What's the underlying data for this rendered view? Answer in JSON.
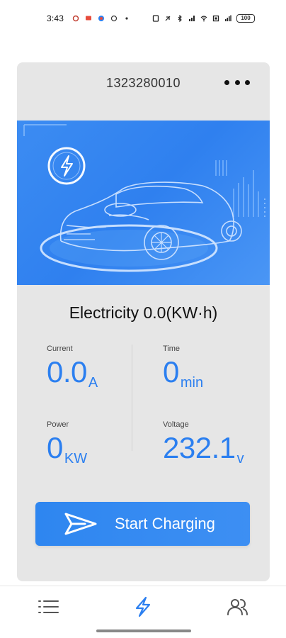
{
  "status_bar": {
    "time": "3:43",
    "battery": "100"
  },
  "device": {
    "id": "1323280010"
  },
  "electricity": {
    "text": "Electricity 0.0(KW·h)"
  },
  "stats": {
    "current": {
      "label": "Current",
      "value": "0.0",
      "unit": "A"
    },
    "time": {
      "label": "Time",
      "value": "0",
      "unit": "min"
    },
    "power": {
      "label": "Power",
      "value": "0",
      "unit": "KW"
    },
    "voltage": {
      "label": "Voltage",
      "value": "232.1",
      "unit": "v"
    }
  },
  "actions": {
    "start_label": "Start Charging"
  },
  "nav": {
    "items": [
      {
        "icon": "list-icon",
        "active": false
      },
      {
        "icon": "lightning-icon",
        "active": true
      },
      {
        "icon": "users-icon",
        "active": false
      }
    ]
  },
  "colors": {
    "accent": "#2b7ff0",
    "banner": "#3c8cf2",
    "card_bg": "#e6e6e6"
  }
}
